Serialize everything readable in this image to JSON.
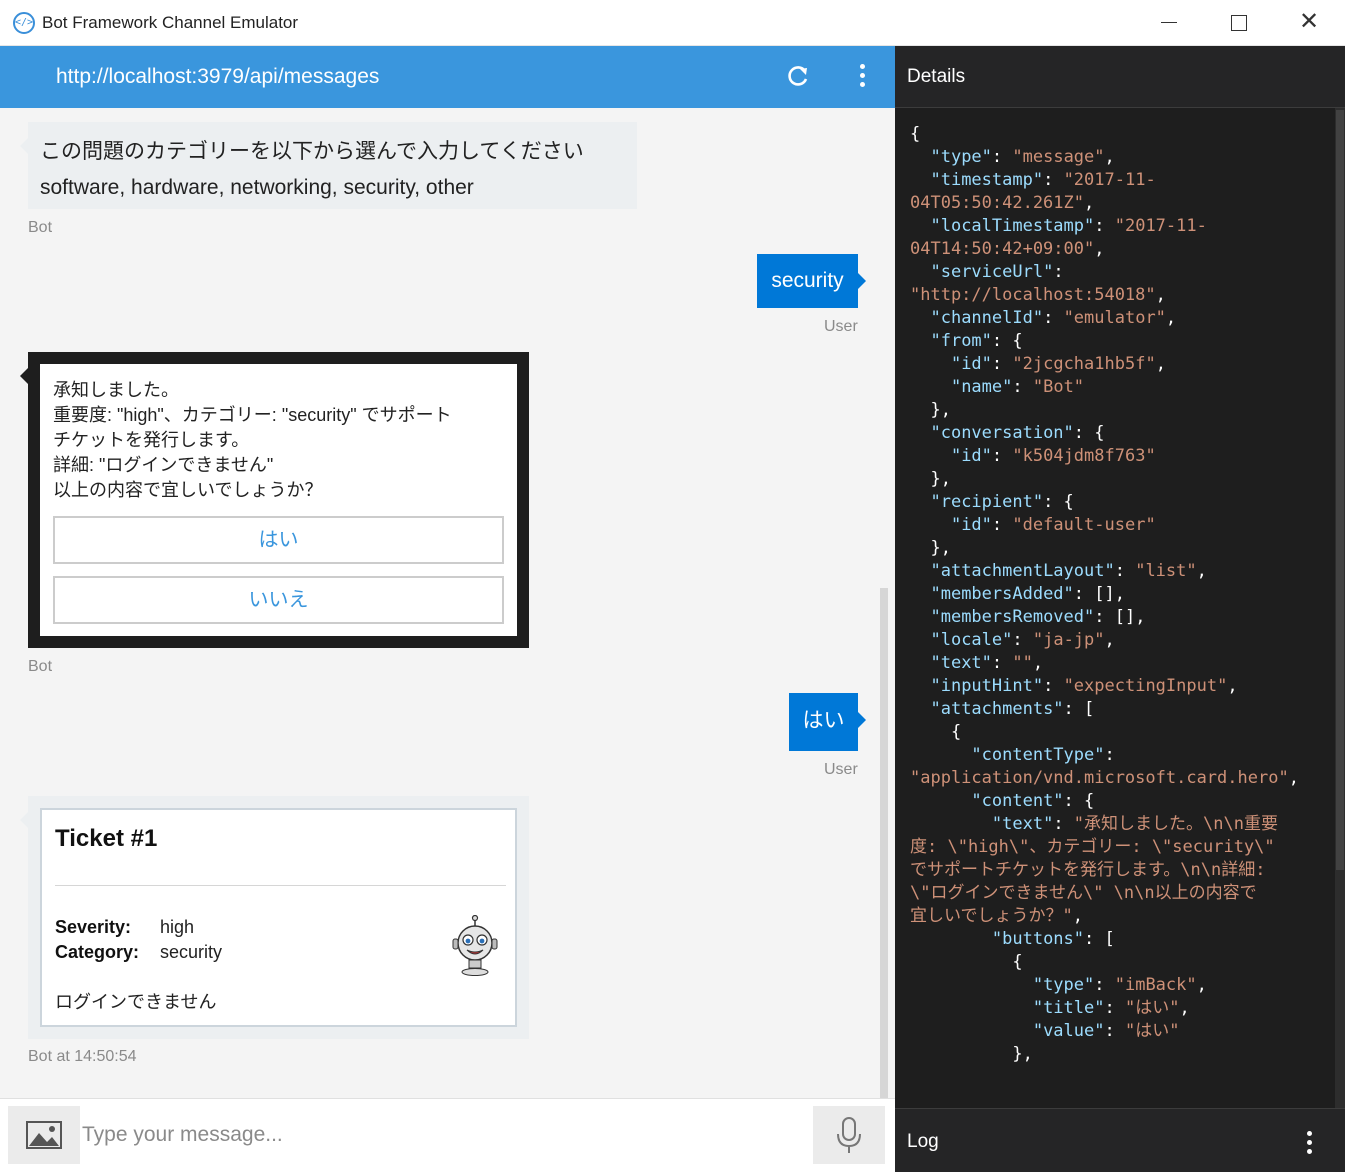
{
  "window": {
    "title": "Bot Framework Channel Emulator",
    "minimize_glyph": "",
    "close_glyph": "✕"
  },
  "chat": {
    "endpoint_url": "http://localhost:3979/api/messages",
    "messages": [
      {
        "from": "bot",
        "lines": [
          "この問題のカテゴリーを以下から選んで入力してください",
          "software, hardware, networking, security, other"
        ],
        "meta": "Bot"
      },
      {
        "from": "user",
        "text": "security",
        "meta": "User"
      },
      {
        "from": "bot",
        "selected": true,
        "lines": [
          "承知しました。",
          "重要度: \"high\"、カテゴリー: \"security\" でサポート",
          "チケットを発行します。",
          "詳細: \"ログインできません\"",
          "以上の内容で宜しいでしょうか？"
        ],
        "buttons": [
          "はい",
          "いいえ"
        ],
        "meta": "Bot"
      },
      {
        "from": "user",
        "text": "はい",
        "meta": "User"
      },
      {
        "from": "bot",
        "ticket": {
          "title": "Ticket #1",
          "severity_label": "Severity:",
          "severity_value": "high",
          "category_label": "Category:",
          "category_value": "security",
          "detail": "ログインできません"
        },
        "meta": "Bot at 14:50:54"
      }
    ]
  },
  "input": {
    "placeholder": "Type your message..."
  },
  "details": {
    "title": "Details",
    "json_lines": [
      [
        [
          "p",
          "{"
        ]
      ],
      [
        [
          "p",
          "  "
        ],
        [
          "k",
          "\"type\""
        ],
        [
          "p",
          ": "
        ],
        [
          "s",
          "\"message\""
        ],
        [
          "p",
          ","
        ]
      ],
      [
        [
          "p",
          "  "
        ],
        [
          "k",
          "\"timestamp\""
        ],
        [
          "p",
          ": "
        ],
        [
          "s",
          "\"2017-11-"
        ]
      ],
      [
        [
          "s",
          "04T05:50:42.261Z\""
        ],
        [
          "p",
          ","
        ]
      ],
      [
        [
          "p",
          "  "
        ],
        [
          "k",
          "\"localTimestamp\""
        ],
        [
          "p",
          ": "
        ],
        [
          "s",
          "\"2017-11-"
        ]
      ],
      [
        [
          "s",
          "04T14:50:42+09:00\""
        ],
        [
          "p",
          ","
        ]
      ],
      [
        [
          "p",
          "  "
        ],
        [
          "k",
          "\"serviceUrl\""
        ],
        [
          "p",
          ":"
        ]
      ],
      [
        [
          "s",
          "\"http://localhost:54018\""
        ],
        [
          "p",
          ","
        ]
      ],
      [
        [
          "p",
          "  "
        ],
        [
          "k",
          "\"channelId\""
        ],
        [
          "p",
          ": "
        ],
        [
          "s",
          "\"emulator\""
        ],
        [
          "p",
          ","
        ]
      ],
      [
        [
          "p",
          "  "
        ],
        [
          "k",
          "\"from\""
        ],
        [
          "p",
          ": {"
        ]
      ],
      [
        [
          "p",
          "    "
        ],
        [
          "k",
          "\"id\""
        ],
        [
          "p",
          ": "
        ],
        [
          "s",
          "\"2jcgcha1hb5f\""
        ],
        [
          "p",
          ","
        ]
      ],
      [
        [
          "p",
          "    "
        ],
        [
          "k",
          "\"name\""
        ],
        [
          "p",
          ": "
        ],
        [
          "s",
          "\"Bot\""
        ]
      ],
      [
        [
          "p",
          "  },"
        ]
      ],
      [
        [
          "p",
          "  "
        ],
        [
          "k",
          "\"conversation\""
        ],
        [
          "p",
          ": {"
        ]
      ],
      [
        [
          "p",
          "    "
        ],
        [
          "k",
          "\"id\""
        ],
        [
          "p",
          ": "
        ],
        [
          "s",
          "\"k504jdm8f763\""
        ]
      ],
      [
        [
          "p",
          "  },"
        ]
      ],
      [
        [
          "p",
          "  "
        ],
        [
          "k",
          "\"recipient\""
        ],
        [
          "p",
          ": {"
        ]
      ],
      [
        [
          "p",
          "    "
        ],
        [
          "k",
          "\"id\""
        ],
        [
          "p",
          ": "
        ],
        [
          "s",
          "\"default-user\""
        ]
      ],
      [
        [
          "p",
          "  },"
        ]
      ],
      [
        [
          "p",
          "  "
        ],
        [
          "k",
          "\"attachmentLayout\""
        ],
        [
          "p",
          ": "
        ],
        [
          "s",
          "\"list\""
        ],
        [
          "p",
          ","
        ]
      ],
      [
        [
          "p",
          "  "
        ],
        [
          "k",
          "\"membersAdded\""
        ],
        [
          "p",
          ": [],"
        ]
      ],
      [
        [
          "p",
          "  "
        ],
        [
          "k",
          "\"membersRemoved\""
        ],
        [
          "p",
          ": [],"
        ]
      ],
      [
        [
          "p",
          "  "
        ],
        [
          "k",
          "\"locale\""
        ],
        [
          "p",
          ": "
        ],
        [
          "s",
          "\"ja-jp\""
        ],
        [
          "p",
          ","
        ]
      ],
      [
        [
          "p",
          "  "
        ],
        [
          "k",
          "\"text\""
        ],
        [
          "p",
          ": "
        ],
        [
          "s",
          "\"\""
        ],
        [
          "p",
          ","
        ]
      ],
      [
        [
          "p",
          "  "
        ],
        [
          "k",
          "\"inputHint\""
        ],
        [
          "p",
          ": "
        ],
        [
          "s",
          "\"expectingInput\""
        ],
        [
          "p",
          ","
        ]
      ],
      [
        [
          "p",
          "  "
        ],
        [
          "k",
          "\"attachments\""
        ],
        [
          "p",
          ": ["
        ]
      ],
      [
        [
          "p",
          "    {"
        ]
      ],
      [
        [
          "p",
          "      "
        ],
        [
          "k",
          "\"contentType\""
        ],
        [
          "p",
          ":"
        ]
      ],
      [
        [
          "s",
          "\"application/vnd.microsoft.card.hero\""
        ],
        [
          "p",
          ","
        ]
      ],
      [
        [
          "p",
          "      "
        ],
        [
          "k",
          "\"content\""
        ],
        [
          "p",
          ": {"
        ]
      ],
      [
        [
          "p",
          "        "
        ],
        [
          "k",
          "\"text\""
        ],
        [
          "p",
          ": "
        ],
        [
          "s",
          "\"承知しました。\\n\\n重要"
        ]
      ],
      [
        [
          "s",
          "度: \\\"high\\\"、カテゴリー: \\\"security\\\""
        ]
      ],
      [
        [
          "s",
          "でサポートチケットを発行します。\\n\\n詳細:"
        ]
      ],
      [
        [
          "s",
          "\\\"ログインできません\\\" \\n\\n以上の内容で"
        ]
      ],
      [
        [
          "s",
          "宜しいでしょうか？\""
        ],
        [
          "p",
          ","
        ]
      ],
      [
        [
          "p",
          "        "
        ],
        [
          "k",
          "\"buttons\""
        ],
        [
          "p",
          ": ["
        ]
      ],
      [
        [
          "p",
          "          {"
        ]
      ],
      [
        [
          "p",
          "            "
        ],
        [
          "k",
          "\"type\""
        ],
        [
          "p",
          ": "
        ],
        [
          "s",
          "\"imBack\""
        ],
        [
          "p",
          ","
        ]
      ],
      [
        [
          "p",
          "            "
        ],
        [
          "k",
          "\"title\""
        ],
        [
          "p",
          ": "
        ],
        [
          "s",
          "\"はい\""
        ],
        [
          "p",
          ","
        ]
      ],
      [
        [
          "p",
          "            "
        ],
        [
          "k",
          "\"value\""
        ],
        [
          "p",
          ": "
        ],
        [
          "s",
          "\"はい\""
        ]
      ],
      [
        [
          "p",
          "          },"
        ]
      ]
    ]
  },
  "log": {
    "title": "Log"
  },
  "colors": {
    "accent": "#3a96dd",
    "user_bubble": "#0078d7",
    "json_key": "#9cdcfe",
    "json_string": "#ce9178"
  }
}
